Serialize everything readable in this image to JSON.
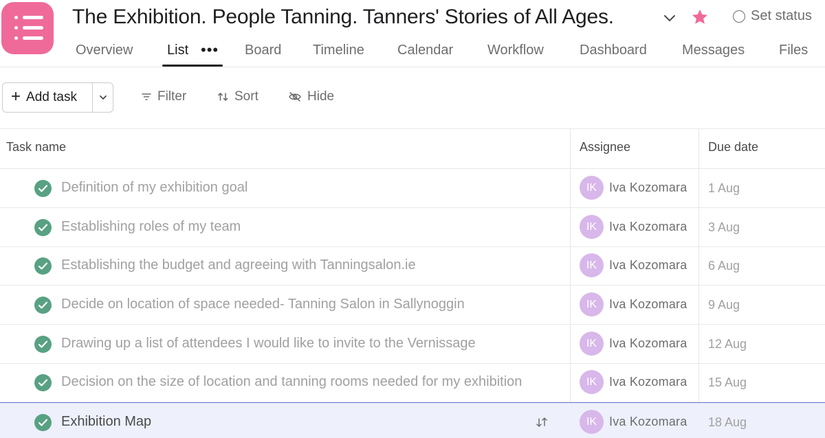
{
  "project": {
    "title": "The Exhibition. People Tanning. Tanners' Stories of All Ages.",
    "icon": "list-icon",
    "accent_color": "#f06a99",
    "favorite_color": "#f06a99"
  },
  "header": {
    "set_status_label": "Set status"
  },
  "tabs": [
    {
      "label": "Overview"
    },
    {
      "label": "List",
      "active": true
    },
    {
      "label": "Board"
    },
    {
      "label": "Timeline"
    },
    {
      "label": "Calendar"
    },
    {
      "label": "Workflow"
    },
    {
      "label": "Dashboard"
    },
    {
      "label": "Messages"
    },
    {
      "label": "Files"
    }
  ],
  "toolbar": {
    "add_task_label": "Add task",
    "filter_label": "Filter",
    "sort_label": "Sort",
    "hide_label": "Hide"
  },
  "table": {
    "columns": {
      "task_name": "Task name",
      "assignee": "Assignee",
      "due_date": "Due date"
    },
    "rows": [
      {
        "name": "Definition of my exhibition goal",
        "assignee_initials": "IK",
        "assignee": "Iva Kozomara",
        "due": "1 Aug",
        "completed": true
      },
      {
        "name": "Establishing roles of my team",
        "assignee_initials": "IK",
        "assignee": "Iva Kozomara",
        "due": "3 Aug",
        "completed": true
      },
      {
        "name": "Establishing the budget and agreeing with Tanningsalon.ie",
        "assignee_initials": "IK",
        "assignee": "Iva Kozomara",
        "due": "6 Aug",
        "completed": true
      },
      {
        "name": "Decide on location of space needed- Tanning Salon in Sallynoggin",
        "assignee_initials": "IK",
        "assignee": "Iva Kozomara",
        "due": "9 Aug",
        "completed": true
      },
      {
        "name": "Drawing up a list of  attendees I would like to invite to the Vernissage",
        "assignee_initials": "IK",
        "assignee": "Iva Kozomara",
        "due": "12 Aug",
        "completed": true
      },
      {
        "name": "Decision on the size of location and tanning rooms needed for my exhibition",
        "assignee_initials": "IK",
        "assignee": "Iva Kozomara",
        "due": "15 Aug",
        "completed": true
      },
      {
        "name": "Exhibition Map",
        "assignee_initials": "IK",
        "assignee": "Iva Kozomara",
        "due": "18 Aug",
        "completed": true,
        "selected": true
      }
    ]
  },
  "colors": {
    "check_green": "#58a182",
    "avatar_bg": "#d8b7ea",
    "selected_row_bg": "#eef0fb"
  }
}
